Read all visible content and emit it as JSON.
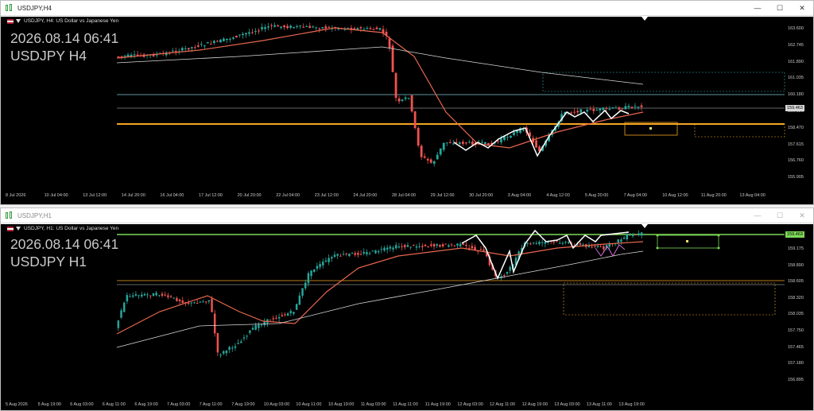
{
  "top": {
    "window_title": "USDJPY,H4",
    "subtitle": "USDJPY, H4:  US Dollar vs Japanese Yen",
    "info_datetime": "2026.08.14 06:41",
    "info_symbol": "USDJPY H4",
    "price_ticks": [
      "163.600",
      "162.745",
      "161.890",
      "161.035",
      "160.180",
      "159.325",
      "158.470",
      "157.615",
      "156.760",
      "155.905"
    ],
    "current_price": "159.463",
    "time_ticks": [
      "8 Jul 2026",
      "10 Jul 04:00",
      "13 Jul 12:00",
      "14 Jul 20:00",
      "16 Jul 04:00",
      "17 Jul 12:00",
      "20 Jul 20:00",
      "22 Jul 04:00",
      "23 Jul 12:00",
      "24 Jul 20:00",
      "28 Jul 04:00",
      "29 Jul 12:00",
      "30 Jul 20:00",
      "3 Aug 04:00",
      "4 Aug 12:00",
      "5 Aug 20:00",
      "7 Aug 04:00",
      "10 Aug 12:00",
      "11 Aug 20:00",
      "13 Aug 04:00"
    ]
  },
  "bottom": {
    "window_title": "USDJPY,H1",
    "subtitle": "USDJPY, H1:  US Dollar vs Japanese Yen",
    "info_datetime": "2026.08.14 06:41",
    "info_symbol": "USDJPY H1",
    "price_ticks": [
      "159.175",
      "158.890",
      "158.605",
      "158.320",
      "158.035",
      "157.750",
      "157.465",
      "157.180",
      "156.895"
    ],
    "current_price": "159.463",
    "time_ticks": [
      "5 Aug 2026",
      "5 Aug 19:00",
      "6 Aug 03:00",
      "6 Aug 11:00",
      "6 Aug 19:00",
      "7 Aug 03:00",
      "7 Aug 11:00",
      "7 Aug 19:00",
      "10 Aug 03:00",
      "10 Aug 11:00",
      "10 Aug 19:00",
      "11 Aug 03:00",
      "11 Aug 11:00",
      "11 Aug 19:00",
      "12 Aug 03:00",
      "12 Aug 11:00",
      "12 Aug 19:00",
      "13 Aug 03:00",
      "13 Aug 11:00",
      "13 Aug 19:00"
    ]
  },
  "window_controls": {
    "minimize": "—",
    "maximize": "☐",
    "close": "✕"
  },
  "colors": {
    "bull": "#26a69a",
    "bear": "#ef5350",
    "ma_fast": "#e8674f",
    "ma_slow": "#d8d8d8",
    "level_orange": "#f5a623",
    "level_green": "#7ed957",
    "zigzag": "#ffffff"
  }
}
